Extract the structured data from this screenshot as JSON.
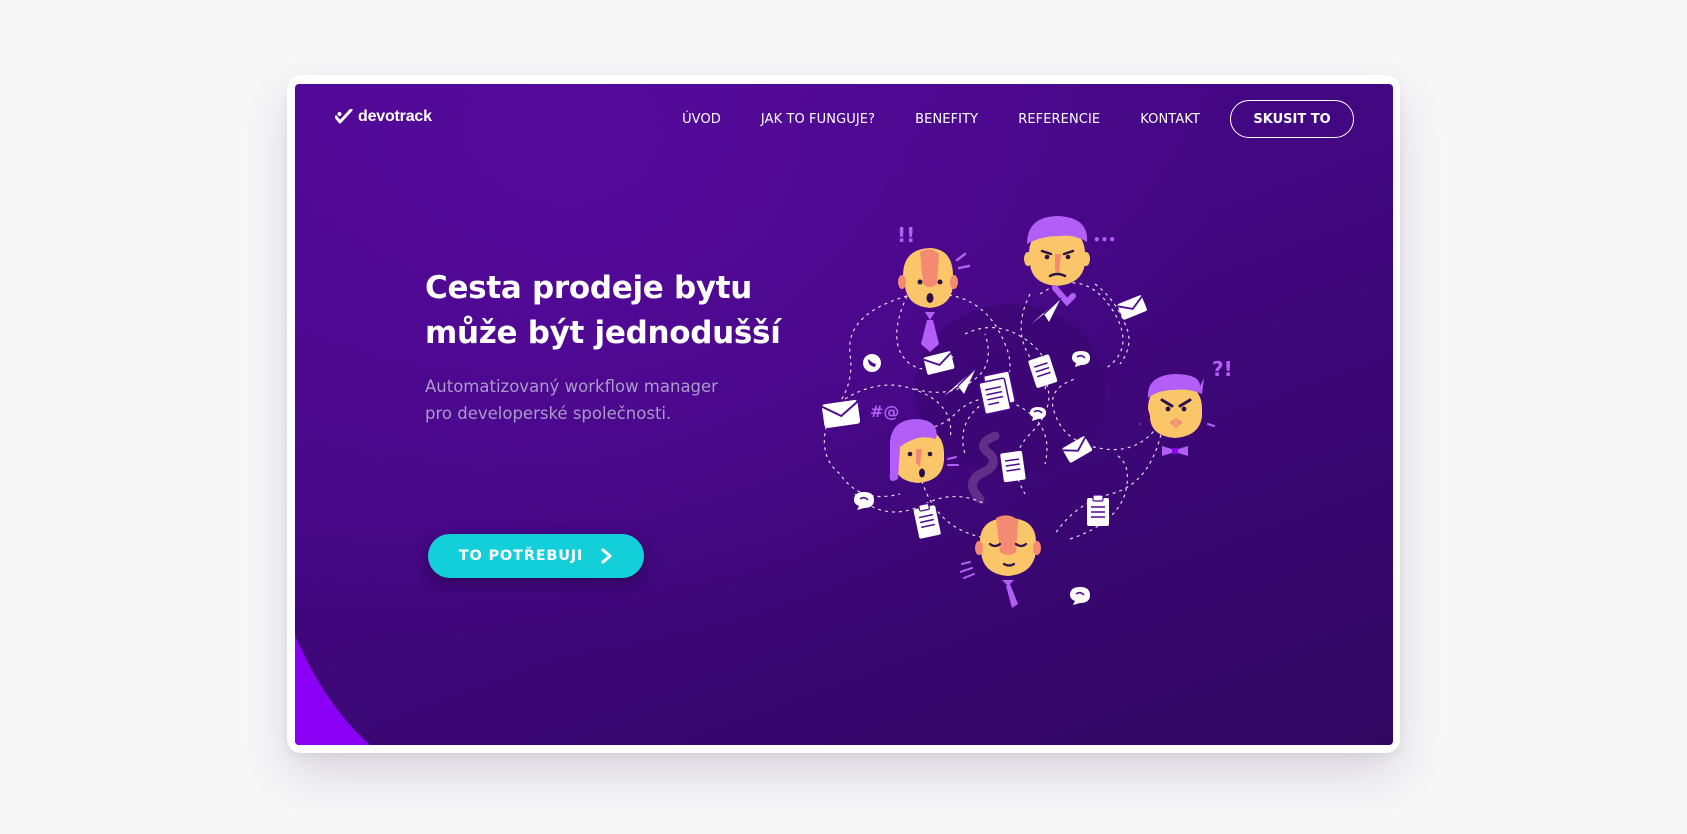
{
  "brand": {
    "name": "devotrack"
  },
  "nav": {
    "items": [
      {
        "label": "ÚVOD"
      },
      {
        "label": "JAK TO FUNGUJE?"
      },
      {
        "label": "BENEFITY"
      },
      {
        "label": "REFERENCIE"
      },
      {
        "label": "KONTAKT"
      }
    ],
    "cta_label": "SKUSIT TO"
  },
  "hero": {
    "headline_lines": [
      "Cesta prodeje bytu",
      "může být jednodušší"
    ],
    "subtitle_lines": [
      "Automatizovaný workflow manager",
      "pro developerské společnosti."
    ],
    "cta_label": "TO POTŘEBUJI"
  },
  "illustration": {
    "symbols": {
      "exclaim": "!!",
      "dots": "•••",
      "interrobang": "?!",
      "hash_at": "#@"
    }
  },
  "colors": {
    "page_bg": "#f7f7f8",
    "hero_bg": "#440883",
    "accent_cyan": "#12cfd9",
    "accent_violet": "#8b00f5",
    "hair_purple": "#b25ef7",
    "skin": "#fbc66a",
    "subtitle": "#a89bc9"
  }
}
